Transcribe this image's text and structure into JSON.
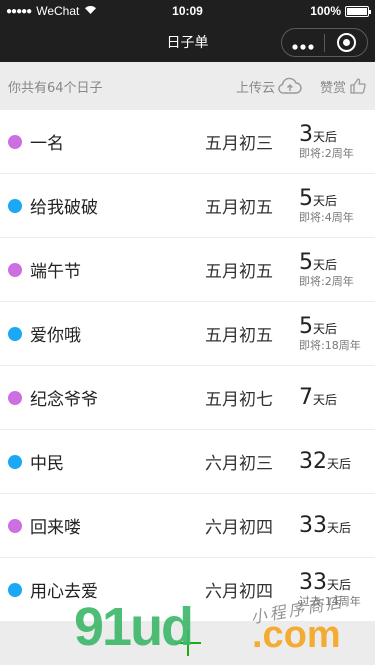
{
  "status": {
    "carrier": "WeChat",
    "signal": "●●●●●",
    "time": "10:09",
    "battery": "100%",
    "battery_level": 1.0
  },
  "nav": {
    "title": "日子单"
  },
  "summary": {
    "count_text": "你共有64个日子",
    "upload_label": "上传云",
    "reward_label": "赞赏"
  },
  "colors": {
    "purple": "#cc6fe0",
    "blue": "#1aa9f2",
    "accent": "#1aad19"
  },
  "rows": [
    {
      "name": "一名",
      "lunar": "五月初三",
      "num": "3",
      "unit": "天后",
      "sub": "即将:2周年",
      "color": "#cc6fe0"
    },
    {
      "name": "给我破破",
      "lunar": "五月初五",
      "num": "5",
      "unit": "天后",
      "sub": "即将:4周年",
      "color": "#1aa9f2"
    },
    {
      "name": "端午节",
      "lunar": "五月初五",
      "num": "5",
      "unit": "天后",
      "sub": "即将:2周年",
      "color": "#cc6fe0"
    },
    {
      "name": "爱你哦",
      "lunar": "五月初五",
      "num": "5",
      "unit": "天后",
      "sub": "即将:18周年",
      "color": "#1aa9f2"
    },
    {
      "name": "纪念爷爷",
      "lunar": "五月初七",
      "num": "7",
      "unit": "天后",
      "sub": "",
      "color": "#cc6fe0"
    },
    {
      "name": "中民",
      "lunar": "六月初三",
      "num": "32",
      "unit": "天后",
      "sub": "",
      "color": "#1aa9f2"
    },
    {
      "name": "回来喽",
      "lunar": "六月初四",
      "num": "33",
      "unit": "天后",
      "sub": "",
      "color": "#cc6fe0"
    },
    {
      "name": "用心去爱",
      "lunar": "六月初四",
      "num": "33",
      "unit": "天后",
      "sub": "过去:14周年",
      "color": "#1aa9f2"
    }
  ],
  "watermark": {
    "main": "91ud",
    "domain": ".com",
    "script": "小程序商店"
  }
}
